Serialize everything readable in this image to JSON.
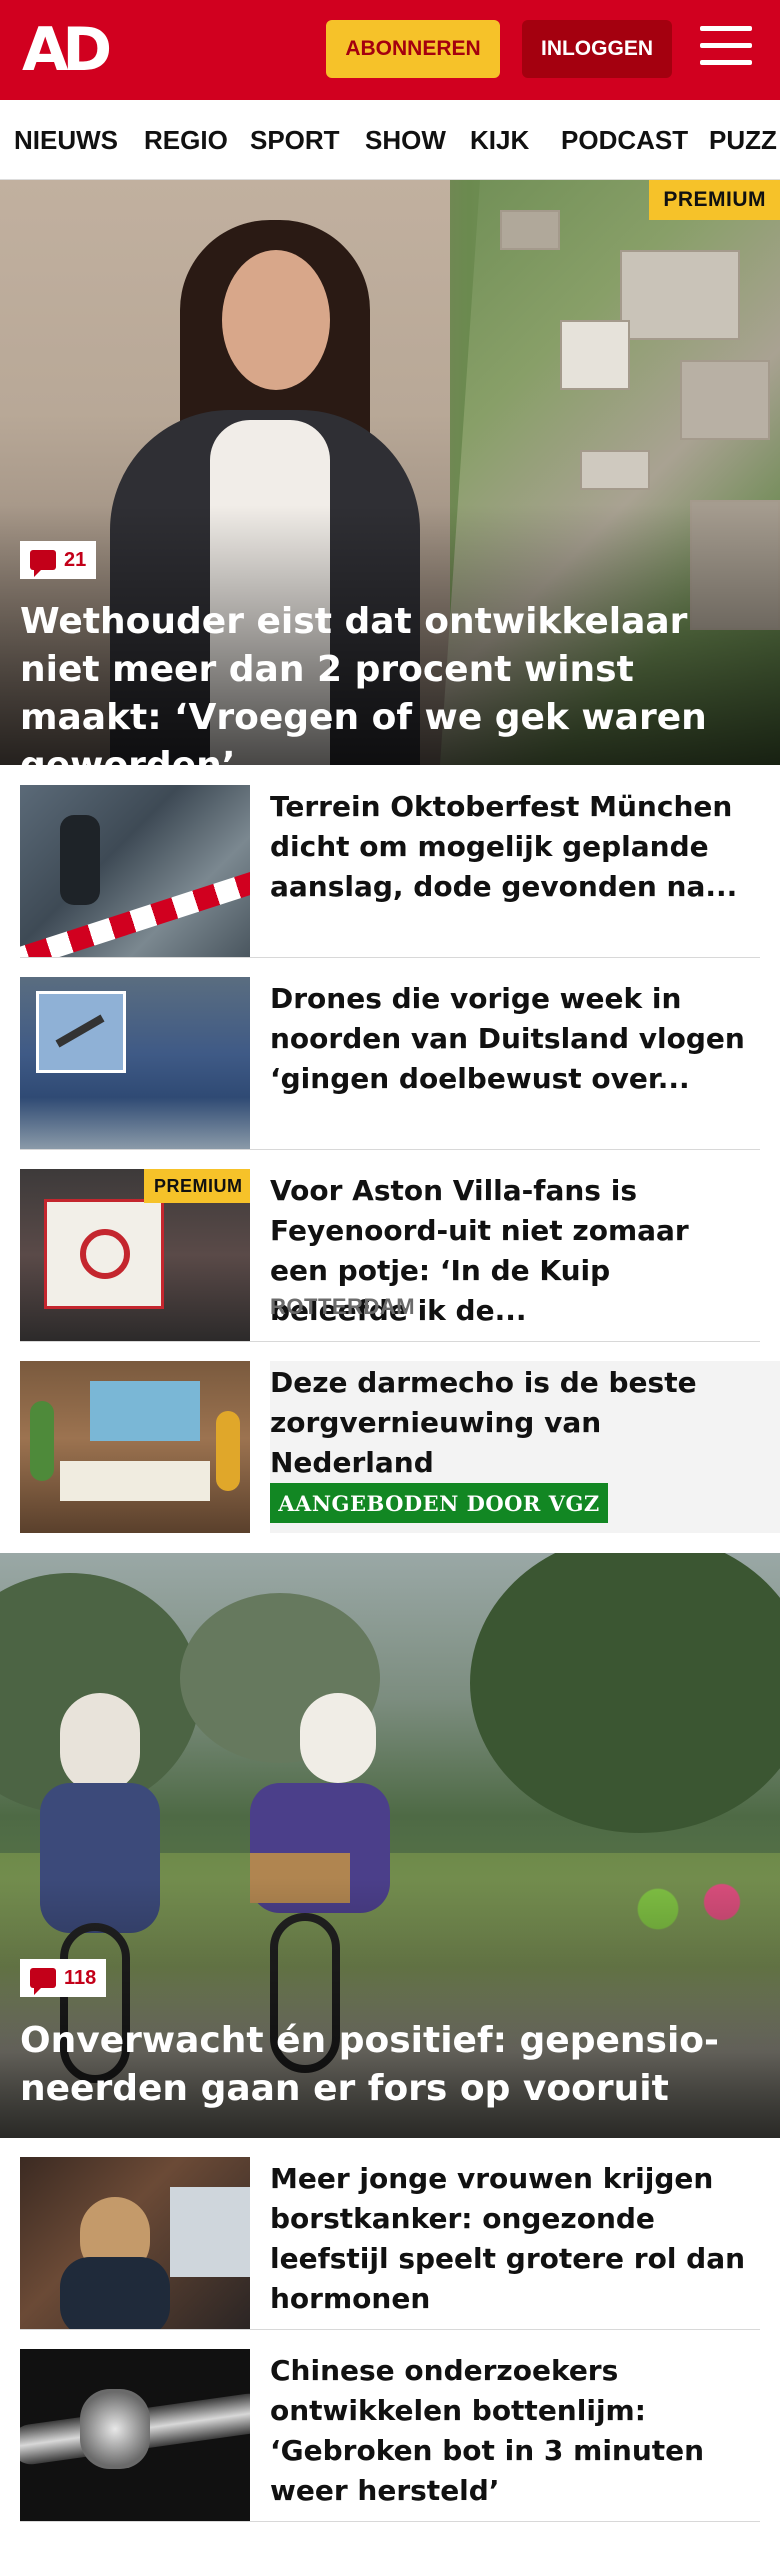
{
  "header": {
    "logo": "AD",
    "subscribe_label": "ABONNEREN",
    "login_label": "INLOGGEN",
    "brand_color": "#d1001f"
  },
  "nav": {
    "items": [
      "NIEUWS",
      "REGIO",
      "SPORT",
      "SHOW",
      "KIJK",
      "PODCAST",
      "PUZZ"
    ]
  },
  "hero1": {
    "premium_label": "PREMIUM",
    "comment_count": "21",
    "title": "Wethouder eist dat ontwikkelaar niet meer dan 2 procent winst maakt: ‘Vroegen of we gek waren geworden’"
  },
  "articles": [
    {
      "title": "Terrein Oktoberfest München dicht om mogelijk geplande aanslag, dode gevonden na..."
    },
    {
      "title": "Drones die vorige week in noorden van Duitsland vlogen ‘gingen doelbewust over..."
    },
    {
      "premium_label": "PREMIUM",
      "title": "Voor Aston Villa-fans is Feyenoord-uit niet zomaar een potje: ‘In de Kuip beleefde ik de...",
      "location": "ROTTERDAM"
    },
    {
      "title": "Deze darmecho is de beste zorgvernieuwing van Nederland",
      "sponsor_label": "AANGEBODEN DOOR VGZ"
    }
  ],
  "hero2": {
    "comment_count": "118",
    "title": "Onverwacht én positief: gepensio­neerden gaan er fors op vooruit"
  },
  "articles2": [
    {
      "title": "Meer jonge vrouwen krijgen borstkanker: ongezonde leefstijl speelt grotere rol dan hormonen"
    },
    {
      "title": "Chinese onderzoekers ontwikke­len bottenlijm: ‘Gebroken bot in 3 minuten weer hersteld’"
    }
  ],
  "icons": [
    "menu-icon",
    "comment-icon"
  ]
}
